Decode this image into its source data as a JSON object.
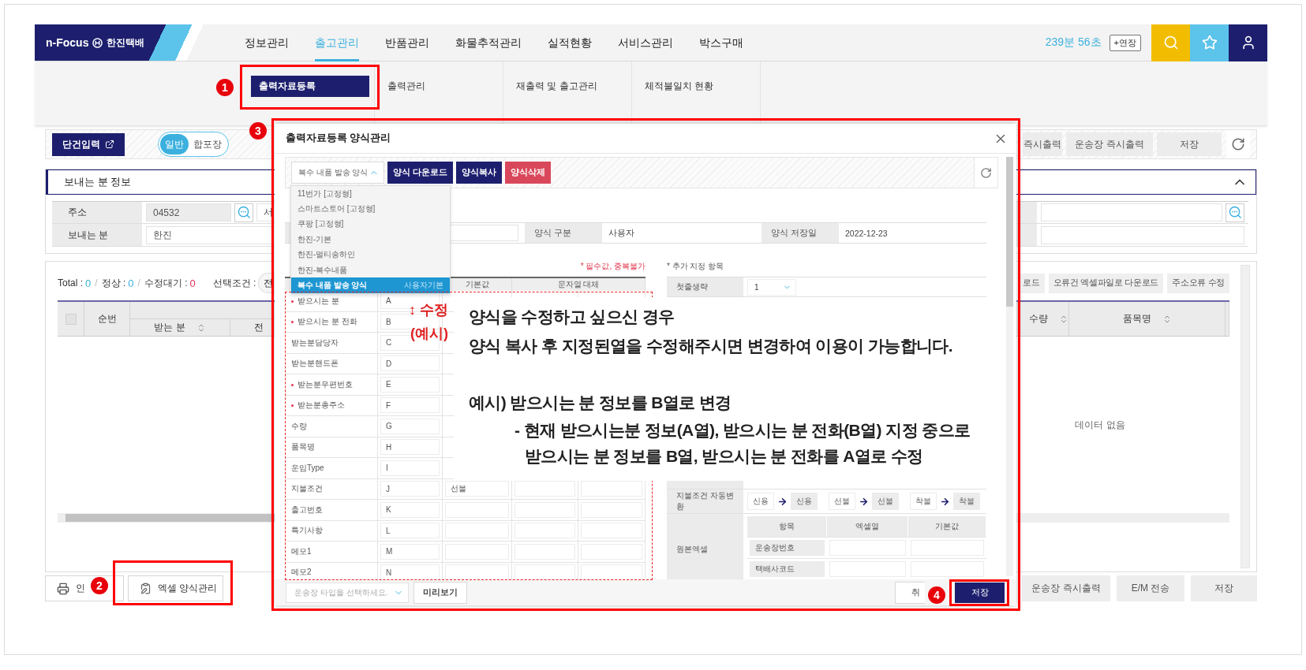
{
  "header": {
    "logo": "n-Focus",
    "brand": "한진택배",
    "nav": [
      {
        "label": "정보관리",
        "selected": false
      },
      {
        "label": "출고관리",
        "selected": true
      },
      {
        "label": "반품관리",
        "selected": false
      },
      {
        "label": "화물추적관리",
        "selected": false
      },
      {
        "label": "실적현황",
        "selected": false
      },
      {
        "label": "서비스관리",
        "selected": false
      },
      {
        "label": "박스구매",
        "selected": false
      }
    ],
    "timer": "239분 56초",
    "extend_button": "+연장"
  },
  "submenu": [
    {
      "label": "출력자료등록",
      "selected": true
    },
    {
      "label": "출력관리",
      "selected": false
    },
    {
      "label": "재출력 및 출고관리",
      "selected": false
    },
    {
      "label": "체적불일치 현황",
      "selected": false
    }
  ],
  "toolbar": {
    "single_entry_button": "단건입력",
    "pack_toggle": [
      {
        "label": "일반",
        "selected": true
      },
      {
        "label": "합포장",
        "selected": false
      }
    ],
    "right_buttons": [
      "즉시출력",
      "운송장 즉시출력",
      "저장"
    ]
  },
  "sender": {
    "title": "보내는 분 정보",
    "expanded": true,
    "address_label": "주소",
    "zip": "04532",
    "address": "서",
    "sender_label": "보내는 분",
    "sender_name": "한진"
  },
  "grid": {
    "summary": [
      {
        "label": "Total :",
        "value": "0",
        "color": "#3bb0de"
      },
      {
        "label": "정상 :",
        "value": "0",
        "color": "#3bb0de"
      },
      {
        "label": "수정대기 :",
        "value": "0",
        "color": "#e0315a"
      }
    ],
    "separator": "/",
    "filter_label": "선택조건 :",
    "filter_value": "전",
    "buttons": [
      "로드",
      "오류건 엑셀파일로 다운로드",
      "주소오류 수정"
    ],
    "select_all_checked": false,
    "left_columns": [
      {
        "label": "순번",
        "kind": "single",
        "sortable": false
      },
      {
        "label": "받는 분",
        "kind": "sub",
        "sortable": true
      },
      {
        "label": "전",
        "kind": "sub",
        "sortable": false
      }
    ],
    "right_columns": [
      {
        "label": "수량",
        "sortable": true
      },
      {
        "label": "품목명",
        "sortable": true
      }
    ],
    "empty_text": "데이터 없음"
  },
  "bottom": {
    "left_buttons": [
      {
        "label": "인",
        "kind": "print"
      },
      {
        "label": "엑셀 양식관리",
        "kind": "excel"
      }
    ],
    "right_buttons": [
      "운송장 즉시출력",
      "E/M 전송",
      "저장"
    ]
  },
  "dialog": {
    "title": "출력자료등록 양식관리",
    "form_select": "복수 내품 발송 양식",
    "dropdown_open": true,
    "actions": [
      {
        "label": "양식 다운로드",
        "kind": "primary"
      },
      {
        "label": "양식복사",
        "kind": "primary"
      },
      {
        "label": "양식삭제",
        "kind": "danger"
      }
    ],
    "options": [
      {
        "label": "11번가 [고정형]",
        "selected": false
      },
      {
        "label": "스마트스토어 [고정형]",
        "selected": false
      },
      {
        "label": "쿠팡 [고정형]",
        "selected": false
      },
      {
        "label": "한진-기본",
        "selected": false
      },
      {
        "label": "한진-멀티송하인",
        "selected": false
      },
      {
        "label": "한진-복수내품",
        "selected": false
      },
      {
        "label": "복수 내품 발송 양식",
        "selected": true,
        "tag": "사용자기본"
      }
    ],
    "info": [
      {
        "label": "양식 구분",
        "value": "사용자"
      },
      {
        "label": "양식 저장일",
        "value": "2022-12-23"
      }
    ],
    "required_note": "* 필수값, 중복불가",
    "mapping_columns": [
      "기본값",
      "문자열 대체"
    ],
    "mapping_rows": [
      {
        "label": "받으시는 분",
        "required": true,
        "column": "A"
      },
      {
        "label": "받으시는 분 전화",
        "required": true,
        "column": "B"
      },
      {
        "label": "받는분담당자",
        "required": false,
        "column": "C"
      },
      {
        "label": "받는분핸드폰",
        "required": false,
        "column": "D"
      },
      {
        "label": "받는분우편번호",
        "required": true,
        "column": "E"
      },
      {
        "label": "받는분총주소",
        "required": true,
        "column": "F"
      },
      {
        "label": "수량",
        "required": false,
        "column": "G"
      },
      {
        "label": "품목명",
        "required": false,
        "column": "H"
      },
      {
        "label": "운임Type",
        "required": false,
        "column": "I"
      },
      {
        "label": "지불조건",
        "required": false,
        "column": "J",
        "default": "선불"
      },
      {
        "label": "출고번호",
        "required": false,
        "column": "K"
      },
      {
        "label": "특기사항",
        "required": false,
        "column": "L"
      },
      {
        "label": "메모1",
        "required": false,
        "column": "M"
      },
      {
        "label": "메모2",
        "required": false,
        "column": "N"
      }
    ],
    "extra_title": "* 추가 지정 항목",
    "skip_first": {
      "label": "첫줄생략",
      "value": "1"
    },
    "payment": {
      "label": "지불조건 자동변환",
      "pairs": [
        {
          "from": "신용",
          "to": "신용"
        },
        {
          "from": "선불",
          "to": "선불"
        },
        {
          "from": "착불",
          "to": "착불"
        }
      ]
    },
    "original_excel": {
      "label": "원본엑셀",
      "columns": [
        "항목",
        "엑셀열",
        "기본값"
      ],
      "rows": [
        "운송장번호",
        "택배사코드"
      ]
    },
    "type_placeholder": "운송장 타입을 선택하세요.",
    "preview_button": "미리보기",
    "cancel_button": "취",
    "save_button": "저장"
  },
  "callout": {
    "edit_mark": "↕ 수정",
    "example_mark": "(예시)",
    "lines": [
      {
        "text": "양식을 수정하고 싶으신 경우",
        "kind": "plain"
      },
      {
        "text": "양식 복사 후 지정된열을 수정해주시면 변경하여 이용이 가능합니다.",
        "kind": "plain"
      },
      {
        "text": "예시) 받으시는 분 정보를 B열로 변경",
        "kind": "example"
      },
      {
        "text": "- 현재 받으시는분 정보(A열), 받으시는 분 전화(B열) 지정 중으로",
        "kind": "detail"
      },
      {
        "text": "받으시는 분 정보를 B열, 받으시는 분 전화를 A열로 수정",
        "kind": "continued"
      }
    ]
  },
  "steps": [
    "1",
    "2",
    "3",
    "4"
  ]
}
